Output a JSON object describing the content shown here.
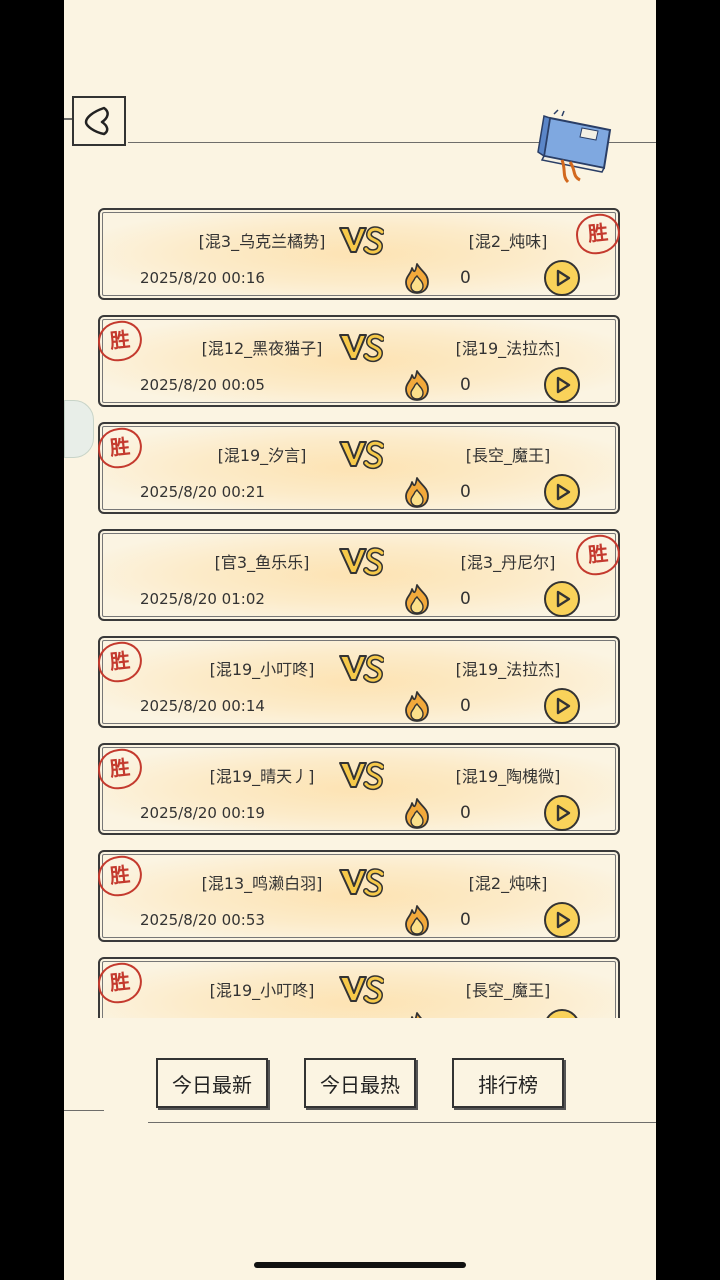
{
  "header": {
    "back_icon": "chevron-left-icon",
    "book_icon": "book-scroll-icon"
  },
  "matches": [
    {
      "player1": "[混3_乌克兰橘势]",
      "player2": "[混2_炖味]",
      "date": "2025/8/20 00:16",
      "heat": "0",
      "winner": "right"
    },
    {
      "player1": "[混12_黑夜猫子]",
      "player2": "[混19_法拉杰]",
      "date": "2025/8/20 00:05",
      "heat": "0",
      "winner": "left"
    },
    {
      "player1": "[混19_汐言]",
      "player2": "[長空_魔王]",
      "date": "2025/8/20 00:21",
      "heat": "0",
      "winner": "left"
    },
    {
      "player1": "[官3_鱼乐乐]",
      "player2": "[混3_丹尼尔]",
      "date": "2025/8/20 01:02",
      "heat": "0",
      "winner": "right"
    },
    {
      "player1": "[混19_小叮咚]",
      "player2": "[混19_法拉杰]",
      "date": "2025/8/20 00:14",
      "heat": "0",
      "winner": "left"
    },
    {
      "player1": "[混19_晴天丿]",
      "player2": "[混19_陶槐微]",
      "date": "2025/8/20 00:19",
      "heat": "0",
      "winner": "left"
    },
    {
      "player1": "[混13_鸣濑白羽]",
      "player2": "[混2_炖味]",
      "date": "2025/8/20 00:53",
      "heat": "0",
      "winner": "left"
    },
    {
      "player1": "[混19_小叮咚]",
      "player2": "[長空_魔王]",
      "date": "",
      "heat": "",
      "winner": "left"
    }
  ],
  "labels": {
    "seal": "胜"
  },
  "tabs": [
    {
      "label": "今日最新"
    },
    {
      "label": "今日最热"
    },
    {
      "label": "排行榜"
    }
  ],
  "colors": {
    "background": "#fbf4e2",
    "seal": "#c43a2e",
    "play_button": "#f9d25a",
    "book": "#7fa8e0"
  }
}
